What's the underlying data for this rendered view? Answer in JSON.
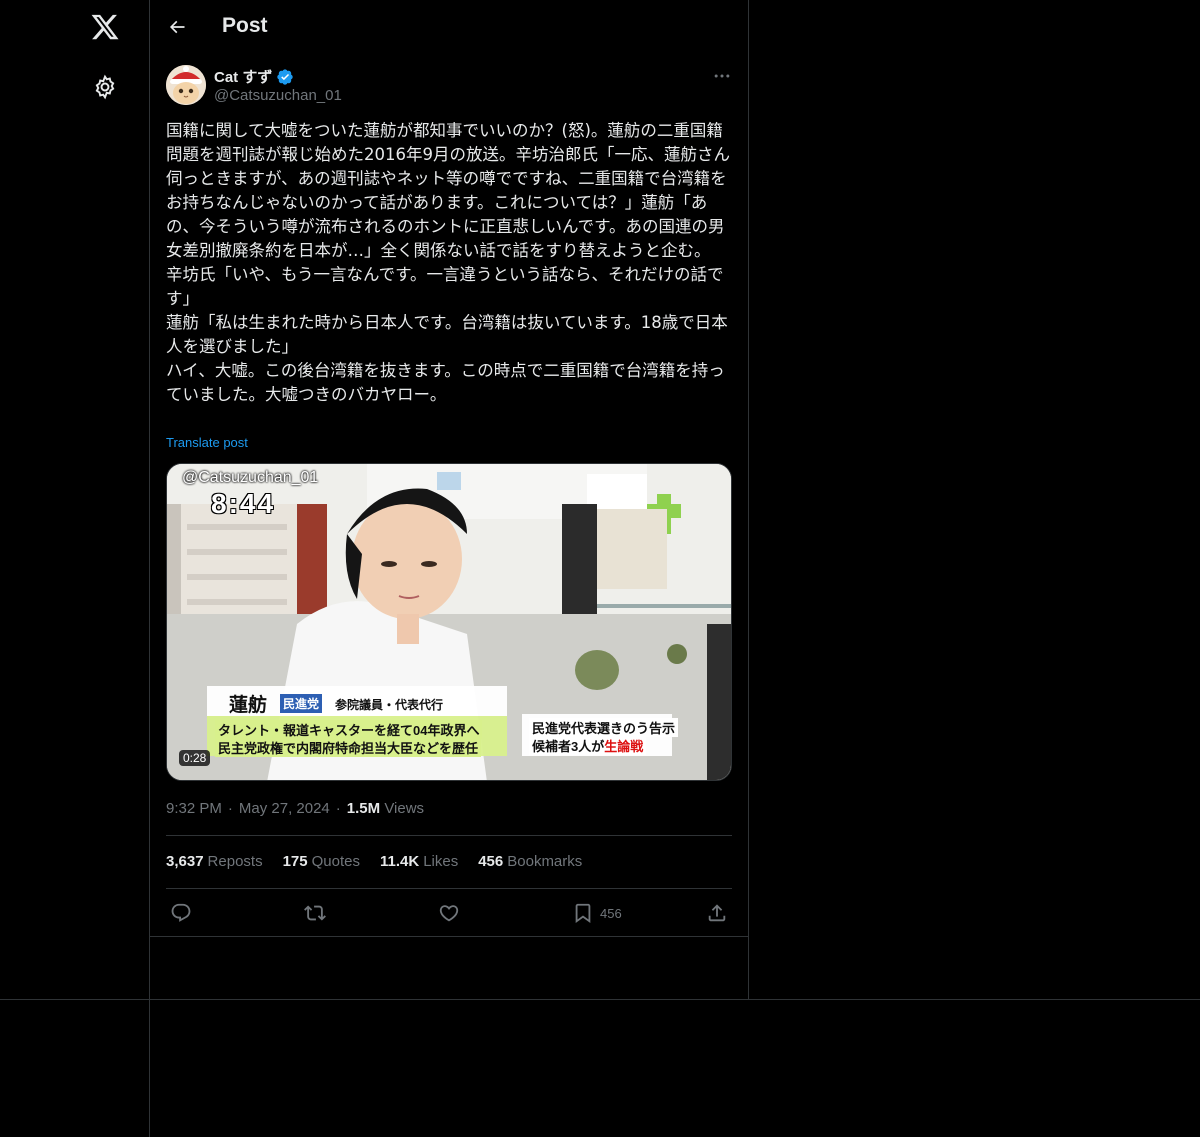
{
  "nav": {
    "logo_icon": "x-logo-icon",
    "settings_icon": "gear-icon"
  },
  "header": {
    "title": "Post",
    "back_icon": "arrow-left-icon"
  },
  "author": {
    "name": "Cat すず",
    "handle": "@Catsuzuchan_01",
    "verified": true
  },
  "post": {
    "lines": [
      "国籍に関して大嘘をついた蓮舫が都知事でいいのか？(怒)。蓮舫の二重国籍問題を週刊誌が報じ始めた2016年9月の放送。辛坊治郎氏「一応、蓮舫さん伺っときますが、あの週刊誌やネット等の噂でですね、二重国籍で台湾籍をお持ちなんじゃないのかって話があります。これについては？」蓮舫「あの、今そういう噂が流布されるのホントに正直悲しいんです。あの国連の男女差別撤廃条約を日本が…」全く関係ない話で話をすり替えようと企む。",
      "辛坊氏「いや、もう一言なんです。一言違うという話なら、それだけの話です」",
      "蓮舫「私は生まれた時から日本人です。台湾籍は抜いています。18歳で日本人を選びました」",
      "ハイ、大嘘。この後台湾籍を抜きます。この時点で二重国籍で台湾籍を持っていました。大嘘つきのバカヤロー。"
    ],
    "translate_label": "Translate post"
  },
  "media": {
    "watermark": "@Catsuzuchan_01",
    "clock": "8:44",
    "duration": "0:28",
    "caption_name": "蓮舫",
    "caption_party": "民進党",
    "caption_title": "参院議員・代表代行",
    "caption_line1": "タレント・報道キャスターを経て04年政界へ",
    "caption_line2": "民主党政権で内閣府特命担当大臣などを歴任",
    "caption_right1": "民進党代表選きのう告示",
    "caption_right2_prefix": "候補者3人が",
    "caption_right2_red": "生論戦"
  },
  "meta": {
    "time": "9:32 PM",
    "dot": "·",
    "date": "May 27, 2024",
    "views_count": "1.5M",
    "views_label": "Views"
  },
  "stats": {
    "reposts_count": "3,637",
    "reposts_label": "Reposts",
    "quotes_count": "175",
    "quotes_label": "Quotes",
    "likes_count": "11.4K",
    "likes_label": "Likes",
    "bookmarks_count": "456",
    "bookmarks_label": "Bookmarks"
  },
  "actions": {
    "reply_icon": "reply-icon",
    "repost_icon": "repost-icon",
    "like_icon": "heart-icon",
    "bookmark_icon": "bookmark-icon",
    "bookmark_count": "456",
    "share_icon": "share-icon"
  },
  "colors": {
    "background": "#000000",
    "text": "#e7e9ea",
    "muted": "#71767b",
    "accent": "#1d9bf0",
    "border": "#2f3336"
  }
}
